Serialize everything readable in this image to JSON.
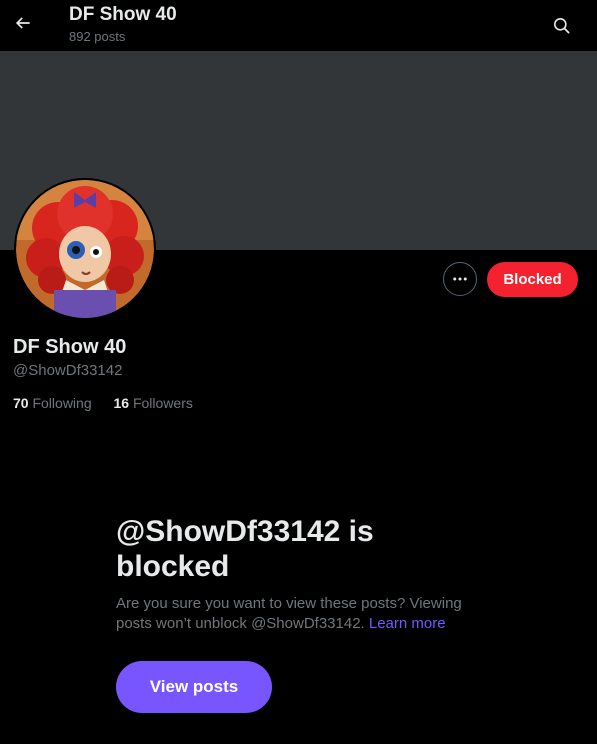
{
  "header": {
    "title": "DF Show 40",
    "post_count": "892 posts",
    "back_icon": "arrow-left-icon",
    "search_icon": "search-icon"
  },
  "profile": {
    "display_name": "DF Show 40",
    "handle": "@ShowDf33142",
    "following_count": "70",
    "following_label": "Following",
    "followers_count": "16",
    "followers_label": "Followers",
    "more_icon": "more-dots-icon",
    "blocked_label": "Blocked"
  },
  "blocked_notice": {
    "heading": "@ShowDf33142 is blocked",
    "description": "Are you sure you want to view these posts? Viewing posts won’t unblock @ShowDf33142.",
    "learn_more": "Learn more",
    "view_posts_label": "View posts"
  },
  "colors": {
    "background": "#000000",
    "banner": "#333639",
    "blocked_red": "#f4212e",
    "accent_purple": "#7856ff",
    "text_primary": "#e7e9ea",
    "text_secondary": "#71767b"
  }
}
